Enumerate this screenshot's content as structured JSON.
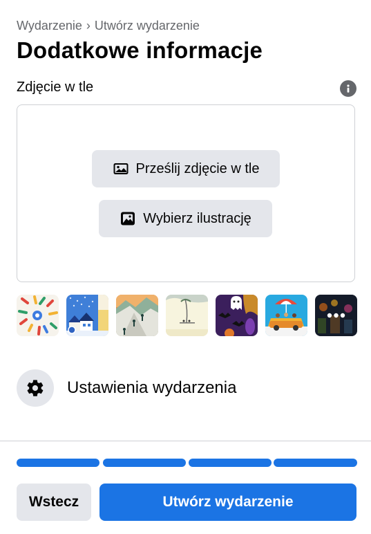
{
  "breadcrumb": {
    "parent": "Wydarzenie",
    "separator": "›",
    "current": "Utwórz wydarzenie"
  },
  "page_title": "Dodatkowe informacje",
  "background_section": {
    "label": "Zdjęcie w tle",
    "info_icon": "info-icon",
    "upload_button": {
      "label": "Prześlij zdjęcie w tle",
      "icon": "image-icon"
    },
    "illustration_button": {
      "label": "Wybierz ilustrację",
      "icon": "illustration-icon"
    }
  },
  "thumbnails": [
    {
      "name": "festive-pattern"
    },
    {
      "name": "winter-village"
    },
    {
      "name": "mountain-hikers"
    },
    {
      "name": "beach-scene"
    },
    {
      "name": "halloween-ghost"
    },
    {
      "name": "summer-car-trip"
    },
    {
      "name": "more-illustrations",
      "overlay": "•••"
    }
  ],
  "settings": {
    "label": "Ustawienia wydarzenia",
    "icon": "gear-icon"
  },
  "progress": {
    "steps_total": 4,
    "steps_complete": 4
  },
  "footer": {
    "back_label": "Wstecz",
    "create_label": "Utwórz wydarzenie"
  },
  "colors": {
    "accent": "#1b74e4",
    "button_gray": "#e4e6eb",
    "secondary_text": "#65676b"
  }
}
